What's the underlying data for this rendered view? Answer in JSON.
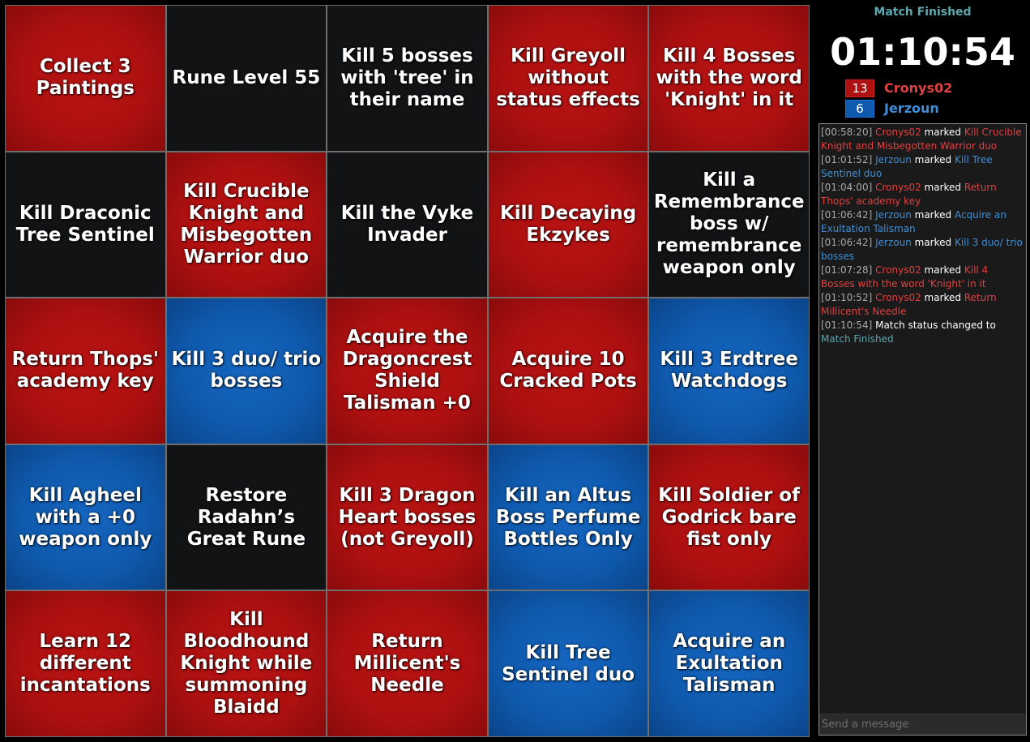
{
  "colors": {
    "red": "#ad1010",
    "blue": "#0f5aae",
    "black": "#121314",
    "red_text": "#e04040",
    "blue_text": "#3e8fd8",
    "status_text": "#5ca9b0",
    "timestamp_text": "#a8a8a8"
  },
  "board": {
    "cells": [
      {
        "text": "Collect 3 Paintings",
        "color": "red"
      },
      {
        "text": "Rune Level 55",
        "color": "black"
      },
      {
        "text": "Kill 5 bosses with 'tree' in their name",
        "color": "black"
      },
      {
        "text": "Kill Greyoll without status effects",
        "color": "red"
      },
      {
        "text": "Kill 4 Bosses with the word 'Knight' in it",
        "color": "red"
      },
      {
        "text": "Kill Draconic Tree Sentinel",
        "color": "black"
      },
      {
        "text": "Kill Crucible Knight and Misbegotten Warrior duo",
        "color": "red"
      },
      {
        "text": "Kill the Vyke Invader",
        "color": "black"
      },
      {
        "text": "Kill Decaying Ekzykes",
        "color": "red"
      },
      {
        "text": "Kill a Remembrance boss w/ remembrance weapon only",
        "color": "black"
      },
      {
        "text": "Return Thops' academy key",
        "color": "red"
      },
      {
        "text": "Kill 3 duo/ trio bosses",
        "color": "blue"
      },
      {
        "text": "Acquire the Dragoncrest Shield Talisman +0",
        "color": "red"
      },
      {
        "text": "Acquire 10 Cracked Pots",
        "color": "red"
      },
      {
        "text": "Kill 3 Erdtree Watchdogs",
        "color": "blue"
      },
      {
        "text": "Kill Agheel with a +0 weapon only",
        "color": "blue"
      },
      {
        "text": "Restore Radahn’s Great Rune",
        "color": "black"
      },
      {
        "text": "Kill 3 Dragon Heart bosses (not Greyoll)",
        "color": "red"
      },
      {
        "text": "Kill an Altus Boss Perfume Bottles Only",
        "color": "blue"
      },
      {
        "text": "Kill Soldier of Godrick bare fist only",
        "color": "red"
      },
      {
        "text": "Learn 12 different incantations",
        "color": "red"
      },
      {
        "text": "Kill Bloodhound Knight while summoning Blaidd",
        "color": "red"
      },
      {
        "text": "Return Millicent's Needle",
        "color": "red"
      },
      {
        "text": "Kill Tree Sentinel duo",
        "color": "blue"
      },
      {
        "text": "Acquire an Exultation Talisman",
        "color": "blue"
      }
    ]
  },
  "sidebar": {
    "status": "Match Finished",
    "timer": "01:10:54",
    "teams": [
      {
        "count": "13",
        "name": "Cronys02",
        "color": "red"
      },
      {
        "count": "6",
        "name": "Jerzoun",
        "color": "blue"
      }
    ],
    "chat": {
      "placeholder": "Send a message",
      "entries": [
        {
          "time": "[00:58:20]",
          "player": "Cronys02",
          "action": " marked ",
          "goal": "Kill Crucible Knight and Misbegotten Warrior duo",
          "color": "red"
        },
        {
          "time": "[01:01:52]",
          "player": "Jerzoun",
          "action": " marked ",
          "goal": "Kill Tree Sentinel duo",
          "color": "blue"
        },
        {
          "time": "[01:04:00]",
          "player": "Cronys02",
          "action": " marked ",
          "goal": "Return Thops' academy key",
          "color": "red"
        },
        {
          "time": "[01:06:42]",
          "player": "Jerzoun",
          "action": " marked ",
          "goal": "Acquire an Exultation Talisman",
          "color": "blue"
        },
        {
          "time": "[01:06:42]",
          "player": "Jerzoun",
          "action": " marked ",
          "goal": "Kill 3 duo/ trio bosses",
          "color": "blue"
        },
        {
          "time": "[01:07:28]",
          "player": "Cronys02",
          "action": " marked ",
          "goal": "Kill 4 Bosses with the word 'Knight' in it",
          "color": "red"
        },
        {
          "time": "[01:10:52]",
          "player": "Cronys02",
          "action": " marked ",
          "goal": "Return Millicent's Needle",
          "color": "red"
        },
        {
          "time": "[01:10:54]",
          "player": "",
          "action": "Match status changed to ",
          "goal": "Match Finished",
          "color": "status"
        }
      ]
    }
  }
}
